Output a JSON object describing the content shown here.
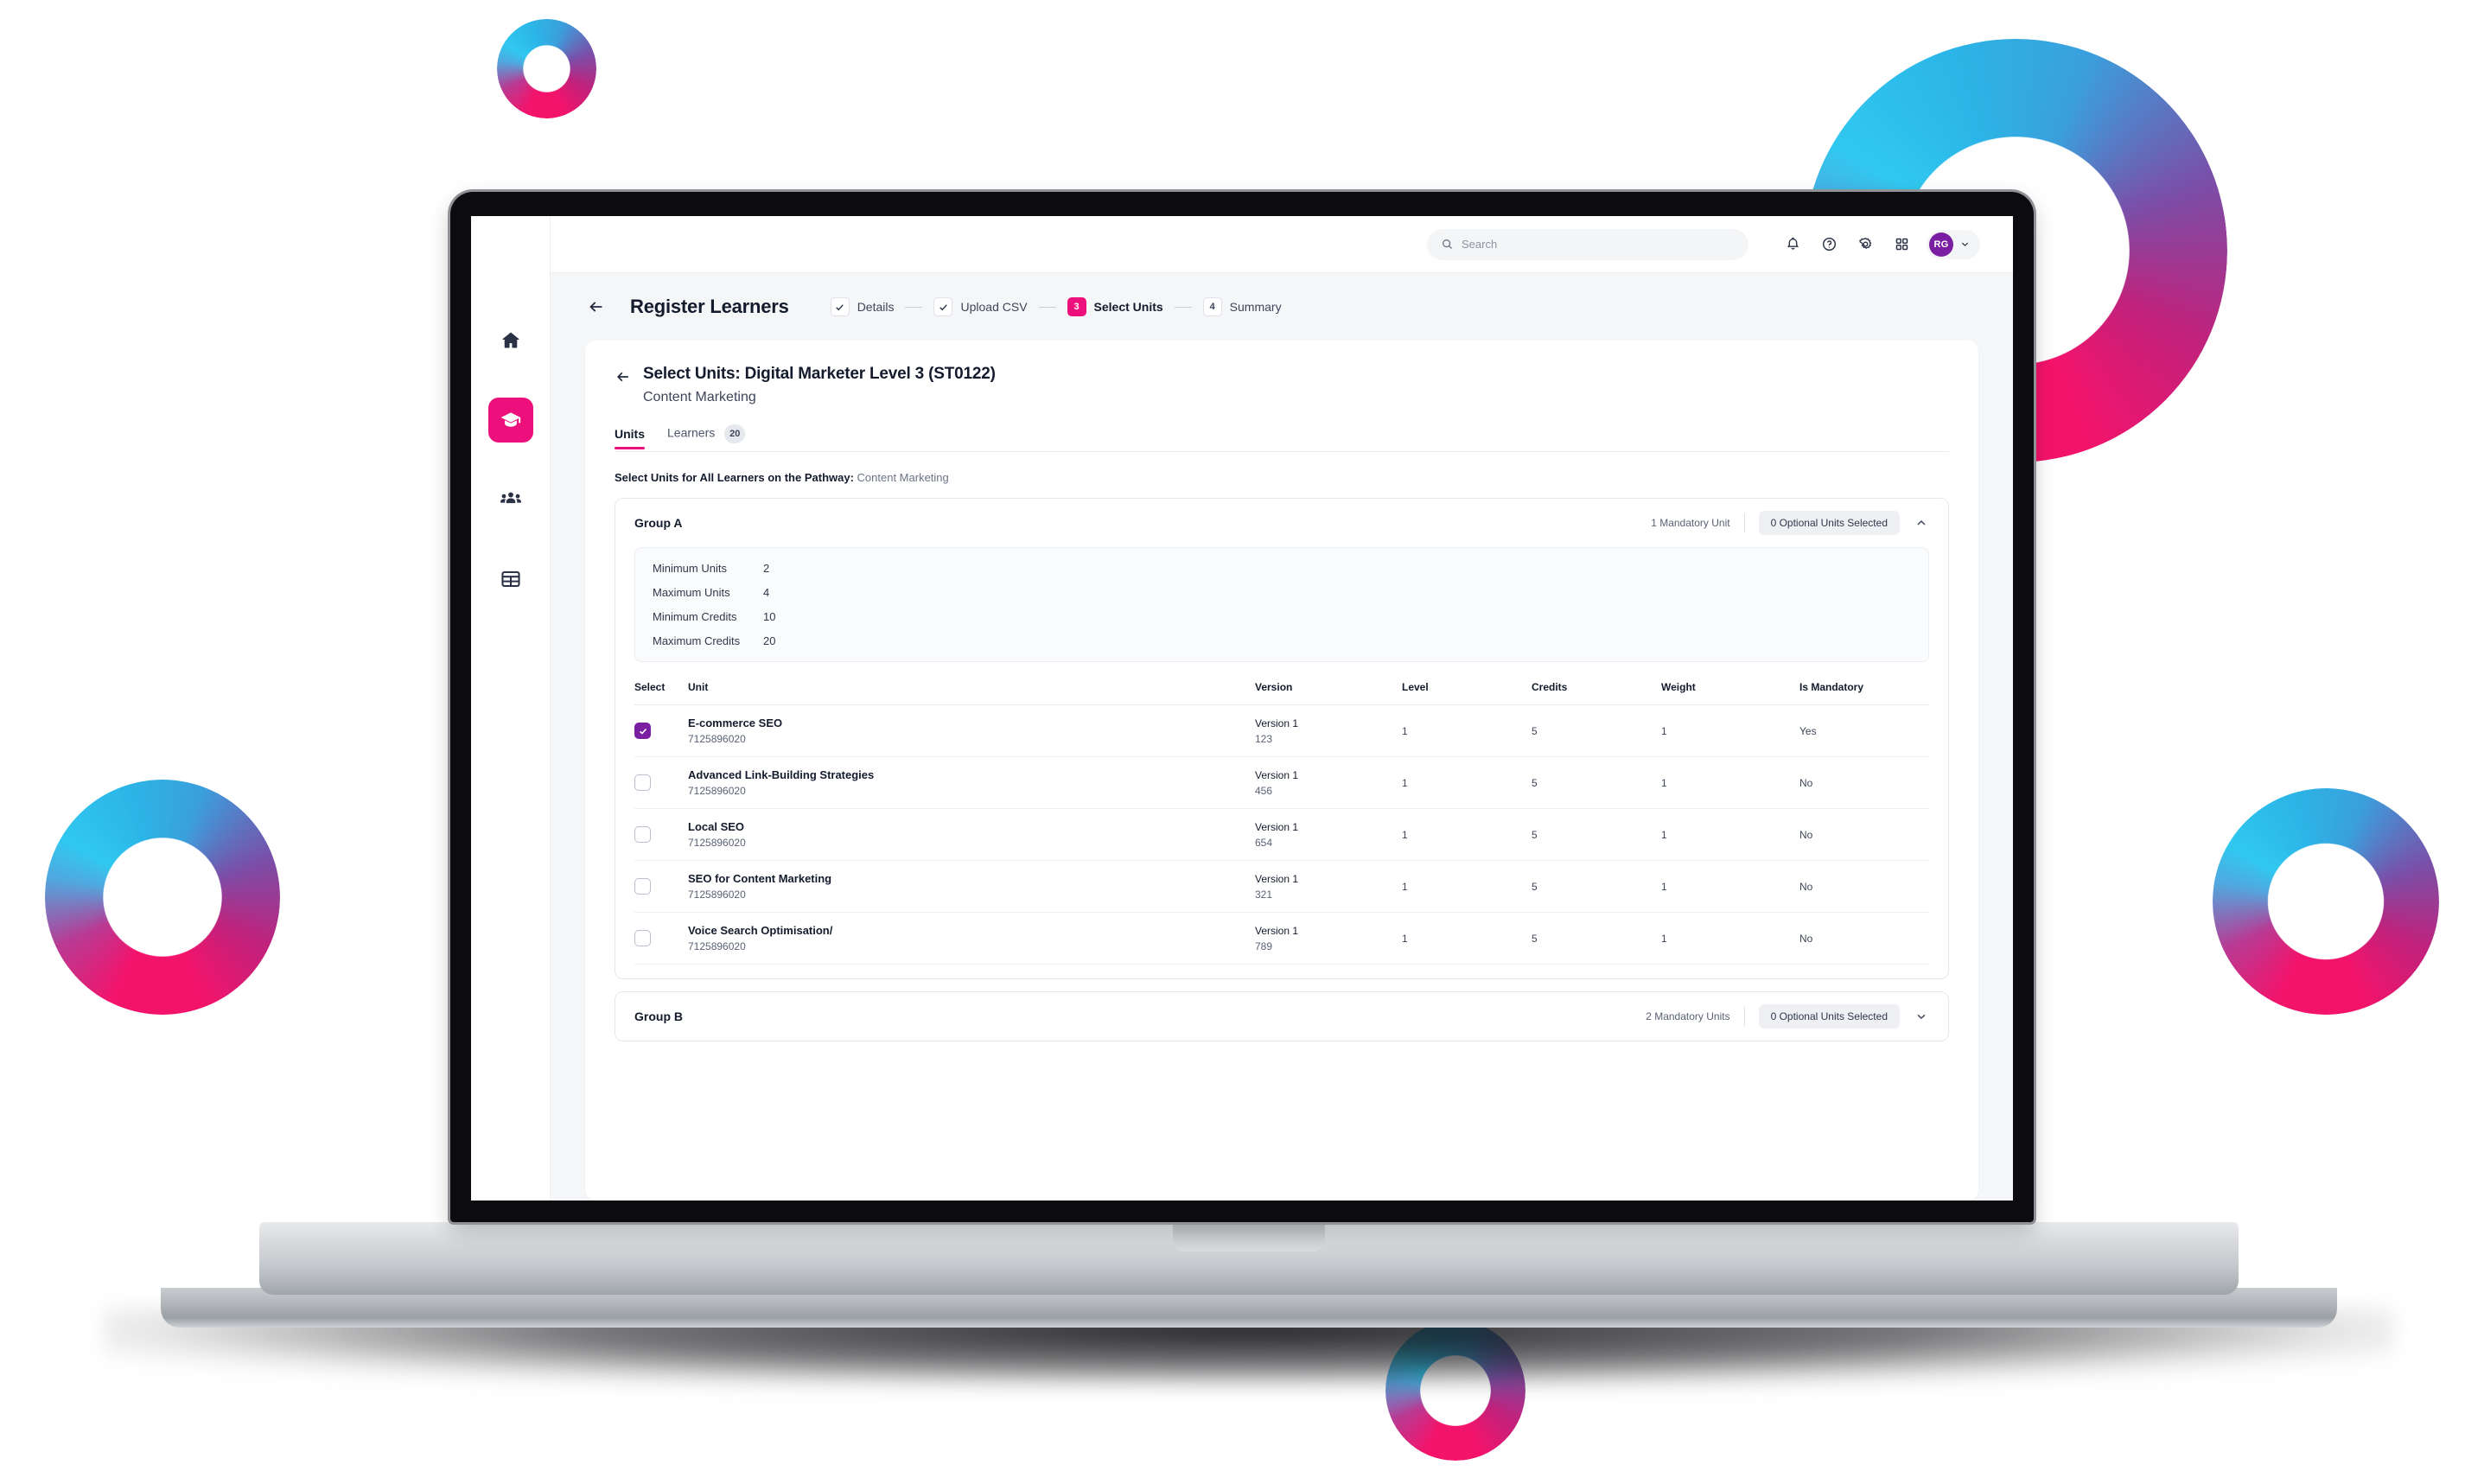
{
  "topbar": {
    "search_placeholder": "Search",
    "search_value": "",
    "icons": [
      "bell-icon",
      "help-icon",
      "settings-icon",
      "apps-grid-icon"
    ],
    "user_initials": "RG"
  },
  "sidebar": {
    "items": [
      {
        "name": "home",
        "active": false
      },
      {
        "name": "learning",
        "active": true
      },
      {
        "name": "people",
        "active": false
      },
      {
        "name": "reports",
        "active": false
      }
    ]
  },
  "pagehead": {
    "title": "Register Learners",
    "steps": [
      {
        "marker": "check",
        "label": "Details",
        "state": "done"
      },
      {
        "marker": "check",
        "label": "Upload CSV",
        "state": "done"
      },
      {
        "marker": "3",
        "label": "Select Units",
        "state": "current"
      },
      {
        "marker": "4",
        "label": "Summary",
        "state": "upcoming"
      }
    ]
  },
  "card": {
    "title": "Select Units: Digital Marketer Level 3 (ST0122)",
    "subtitle": "Content Marketing",
    "tabs": [
      {
        "label": "Units",
        "badge": "",
        "active": true
      },
      {
        "label": "Learners",
        "badge": "20",
        "active": false
      }
    ],
    "section_note_bold": "Select Units for All Learners on the Pathway:",
    "section_note_rest": " Content Marketing"
  },
  "group_a": {
    "name": "Group A",
    "mandatory_text": "1 Mandatory Unit",
    "optional_pill": "0 Optional Units Selected",
    "chevron": "chevron-up-icon",
    "stats": [
      {
        "key": "Minimum Units",
        "value": "2"
      },
      {
        "key": "Maximum Units",
        "value": "4"
      },
      {
        "key": "Minimum Credits",
        "value": "10"
      },
      {
        "key": "Maximum Credits",
        "value": "20"
      }
    ],
    "columns": [
      "Select",
      "Unit",
      "Version",
      "Level",
      "Credits",
      "Weight",
      "Is Mandatory"
    ],
    "rows": [
      {
        "checked": true,
        "unit": "E-commerce SEO",
        "code": "7125896020",
        "version_label": "Version 1",
        "version_num": "123",
        "level": "1",
        "credits": "5",
        "weight": "1",
        "mandatory": "Yes"
      },
      {
        "checked": false,
        "unit": "Advanced Link-Building Strategies",
        "code": "7125896020",
        "version_label": "Version 1",
        "version_num": "456",
        "level": "1",
        "credits": "5",
        "weight": "1",
        "mandatory": "No"
      },
      {
        "checked": false,
        "unit": "Local SEO",
        "code": "7125896020",
        "version_label": "Version 1",
        "version_num": "654",
        "level": "1",
        "credits": "5",
        "weight": "1",
        "mandatory": "No"
      },
      {
        "checked": false,
        "unit": "SEO for Content Marketing",
        "code": "7125896020",
        "version_label": "Version 1",
        "version_num": "321",
        "level": "1",
        "credits": "5",
        "weight": "1",
        "mandatory": "No"
      },
      {
        "checked": false,
        "unit": "Voice Search Optimisation/",
        "code": "7125896020",
        "version_label": "Version 1",
        "version_num": "789",
        "level": "1",
        "credits": "5",
        "weight": "1",
        "mandatory": "No"
      }
    ]
  },
  "group_b": {
    "name": "Group B",
    "mandatory_text": "2 Mandatory Units",
    "optional_pill": "0 Optional Units Selected",
    "chevron": "chevron-down-icon"
  },
  "colors": {
    "accent_pink": "#ec0f7c",
    "accent_purple": "#7b1fa2",
    "ring_cyan": "#31c8ef",
    "ring_magenta": "#f4136b",
    "app_bg": "#f5f6f8"
  }
}
